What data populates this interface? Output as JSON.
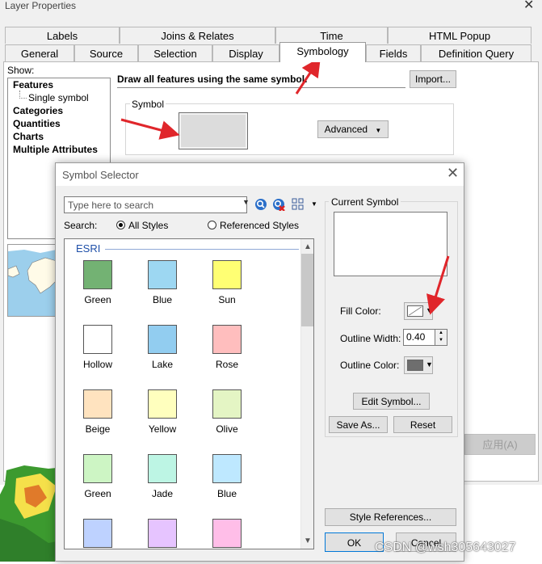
{
  "layer_properties": {
    "title": "Layer Properties",
    "close_glyph": "✕",
    "tabs_row1": [
      "Labels",
      "Joins & Relates",
      "Time",
      "HTML Popup"
    ],
    "tabs_row2": [
      "General",
      "Source",
      "Selection",
      "Display",
      "Symbology",
      "Fields",
      "Definition Query"
    ],
    "active_tab": "Symbology",
    "show_label": "Show:",
    "tree": {
      "features": "Features",
      "single_symbol": "Single symbol",
      "categories": "Categories",
      "quantities": "Quantities",
      "charts": "Charts",
      "multiple_attributes": "Multiple Attributes"
    },
    "description": "Draw all features using the same symbol.",
    "import_label": "Import...",
    "symbol_group_label": "Symbol",
    "advanced_label": "Advanced",
    "apply_label": "应用(A)",
    "symbol_fill": "#dcdcdc"
  },
  "symbol_selector": {
    "title": "Symbol Selector",
    "search_placeholder": "Type here to search",
    "search_label": "Search:",
    "radio_all_styles": "All Styles",
    "radio_referenced_styles": "Referenced Styles",
    "selected_radio": "All Styles",
    "gallery_header": "ESRI",
    "symbols": [
      {
        "label": "Green",
        "color": "#73b273"
      },
      {
        "label": "Blue",
        "color": "#9dd7f2"
      },
      {
        "label": "Sun",
        "color": "#ffff73"
      },
      {
        "label": "Hollow",
        "color": "#ffffff"
      },
      {
        "label": "Lake",
        "color": "#92cdf0"
      },
      {
        "label": "Rose",
        "color": "#ffbebe"
      },
      {
        "label": "Beige",
        "color": "#ffe3bf"
      },
      {
        "label": "Yellow",
        "color": "#ffffbe"
      },
      {
        "label": "Olive",
        "color": "#e4f5c4"
      },
      {
        "label": "Green",
        "color": "#cdf5c4"
      },
      {
        "label": "Jade",
        "color": "#bdf5e4"
      },
      {
        "label": "Blue",
        "color": "#bee8ff"
      },
      {
        "label": "",
        "color": "#bed2ff"
      },
      {
        "label": "",
        "color": "#e6c4ff"
      },
      {
        "label": "",
        "color": "#ffbee8"
      }
    ],
    "current_symbol_label": "Current Symbol",
    "fill_color_label": "Fill Color:",
    "outline_width_label": "Outline Width:",
    "outline_width_value": "0.40",
    "outline_color_label": "Outline Color:",
    "outline_color": "#6e6e6e",
    "edit_symbol_label": "Edit Symbol...",
    "save_as_label": "Save As...",
    "reset_label": "Reset",
    "style_references_label": "Style References...",
    "ok_label": "OK",
    "cancel_label": "Cancel"
  },
  "watermark": "CSDN @wsh305643027",
  "annotation_color": "#e0262b"
}
